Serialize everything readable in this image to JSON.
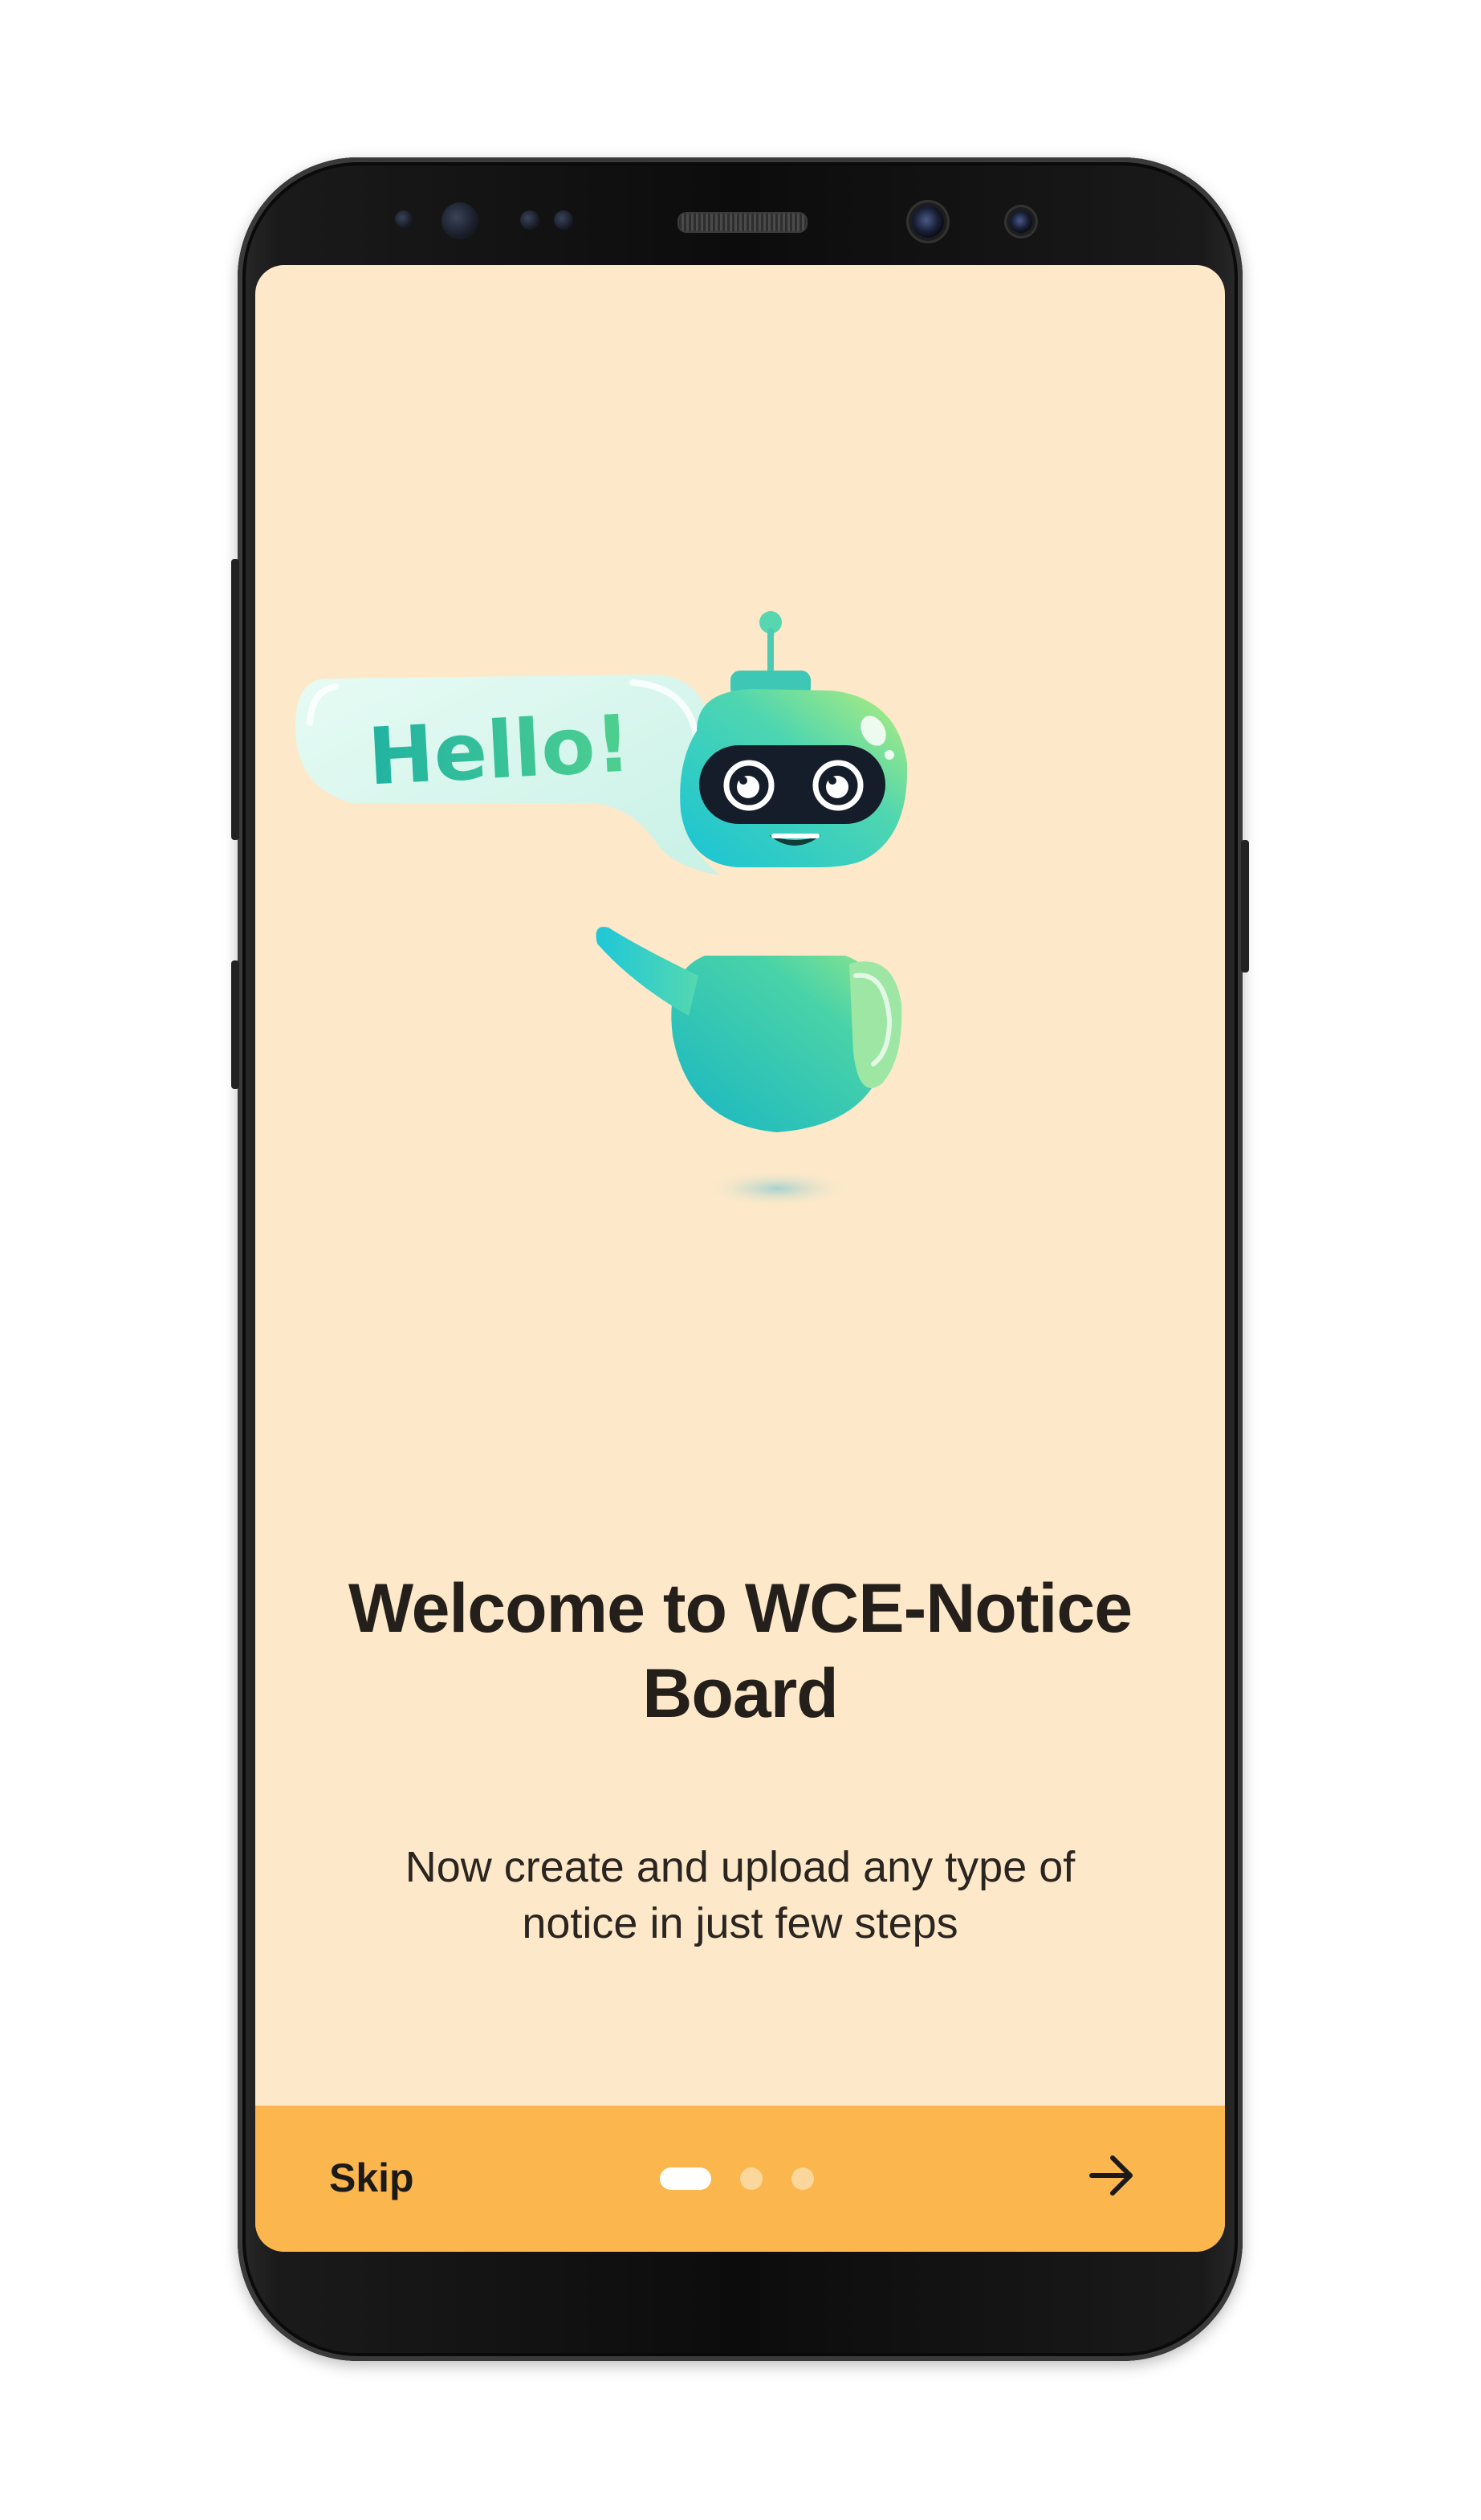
{
  "onboarding": {
    "illustration": {
      "bubble_text": "Hello!",
      "character": "robot-illustration"
    },
    "title": "Welcome to WCE-Notice Board",
    "subtitle": "Now create and upload any type of notice in just few steps",
    "pager": {
      "total_pages": 3,
      "current_page": 1
    },
    "bottom_bar": {
      "skip_label": "Skip",
      "next_icon": "arrow-right-icon"
    }
  },
  "colors": {
    "screen_background": "#fde9c9",
    "bottom_bar": "#fbb64e",
    "title_text": "#241f1a",
    "dot_active": "#ffffff",
    "dot_inactive": "#fcd79b",
    "robot_primary": "#3ccfb8"
  }
}
